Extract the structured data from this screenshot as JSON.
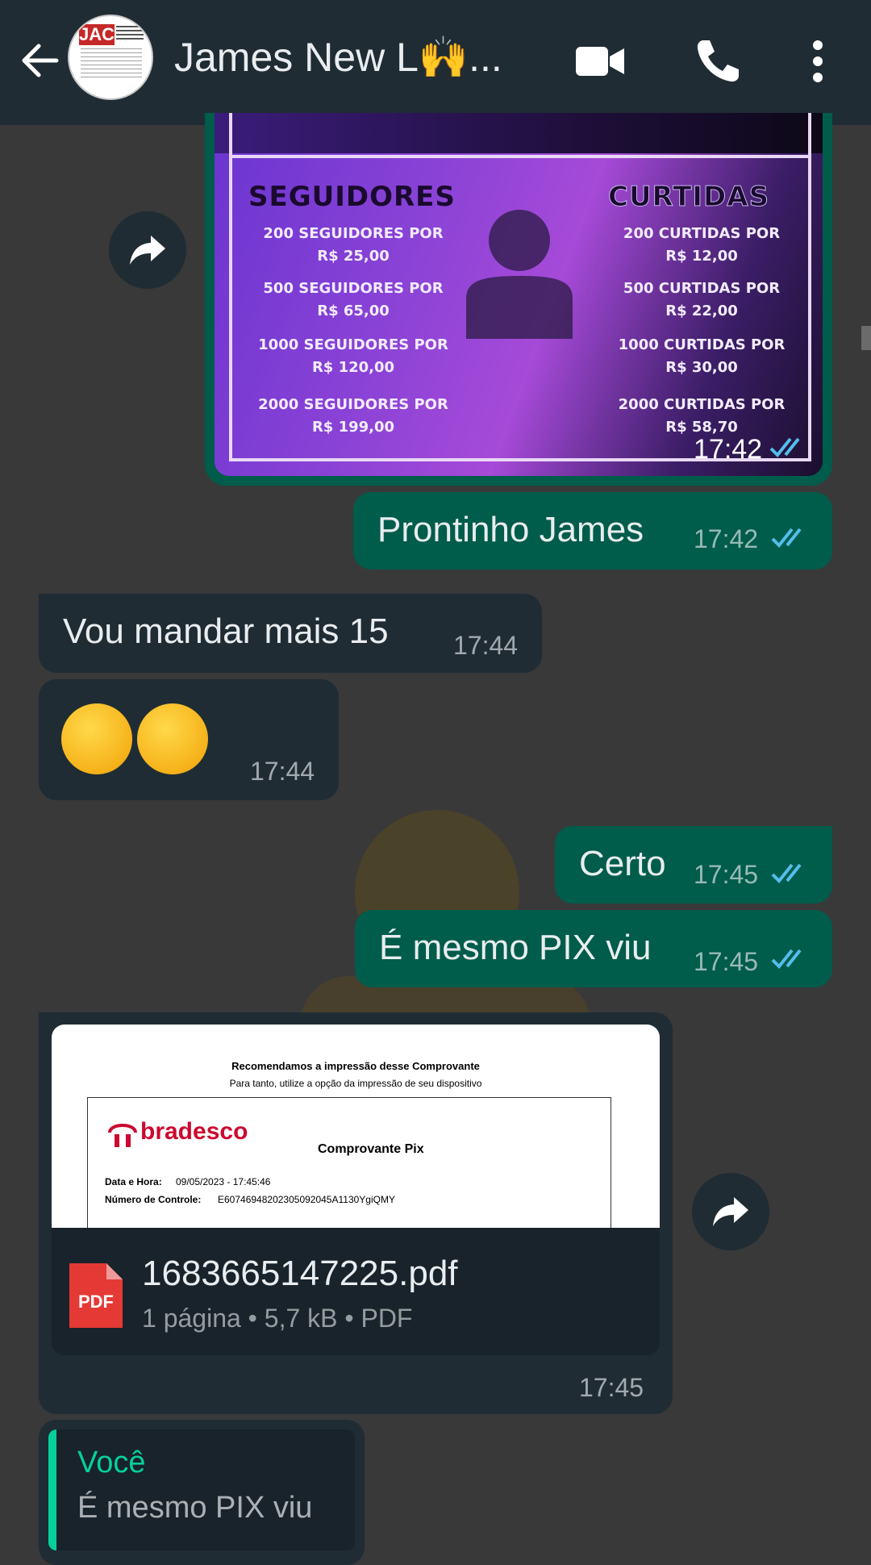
{
  "header": {
    "contact_name": "James New L🙌...",
    "icons": [
      "back-arrow-icon",
      "video-camera-icon",
      "phone-icon",
      "more-vertical-icon"
    ]
  },
  "promo_image": {
    "seguidores_title": "SEGUIDORES",
    "curtidas_title": "CURTIDAS",
    "seguidores": [
      {
        "line1": "200 SEGUIDORES POR",
        "line2": "R$ 25,00"
      },
      {
        "line1": "500 SEGUIDORES POR",
        "line2": "R$ 65,00"
      },
      {
        "line1": "1000 SEGUIDORES POR",
        "line2": "R$ 120,00"
      },
      {
        "line1": "2000 SEGUIDORES POR",
        "line2": "R$ 199,00"
      }
    ],
    "curtidas": [
      {
        "line1": "200 CURTIDAS POR",
        "line2": "R$ 12,00"
      },
      {
        "line1": "500 CURTIDAS POR",
        "line2": "R$ 22,00"
      },
      {
        "line1": "1000 CURTIDAS POR",
        "line2": "R$ 30,00"
      },
      {
        "line1": "2000 CURTIDAS POR",
        "line2": "R$ 58,70"
      }
    ],
    "time": "17:42"
  },
  "messages": [
    {
      "text": "Prontinho James",
      "time": "17:42",
      "direction": "out"
    },
    {
      "text": "Vou mandar mais 15",
      "time": "17:44",
      "direction": "in"
    },
    {
      "emoji": "😉😉",
      "time": "17:44",
      "direction": "in"
    },
    {
      "text": "Certo",
      "time": "17:45",
      "direction": "out"
    },
    {
      "text": "É mesmo PIX viu",
      "time": "17:45",
      "direction": "out"
    }
  ],
  "document": {
    "preview": {
      "line1": "Recomendamos a impressão desse Comprovante",
      "line2": "Para tanto, utilize a opção da impressão de seu dispositivo",
      "bank": "bradesco",
      "title": "Comprovante Pix",
      "date_label": "Data e Hora:",
      "date_value": "09/05/2023 - 17:45:46",
      "control_label": "Número de Controle:",
      "control_value": "E60746948202305092045A1130YgiQMY"
    },
    "filename": "1683665147225.pdf",
    "meta": "1 página • 5,7 kB • PDF",
    "icon_label": "PDF",
    "time": "17:45"
  },
  "reply": {
    "author": "Você",
    "quoted_text": "É mesmo PIX viu"
  },
  "colors": {
    "header_bg": "#1f2c34",
    "chat_bg": "#393939",
    "outgoing_bubble": "#005c4b",
    "incoming_bubble": "#1f2c34",
    "read_ticks": "#53bdeb",
    "accent": "#06cf9c"
  }
}
